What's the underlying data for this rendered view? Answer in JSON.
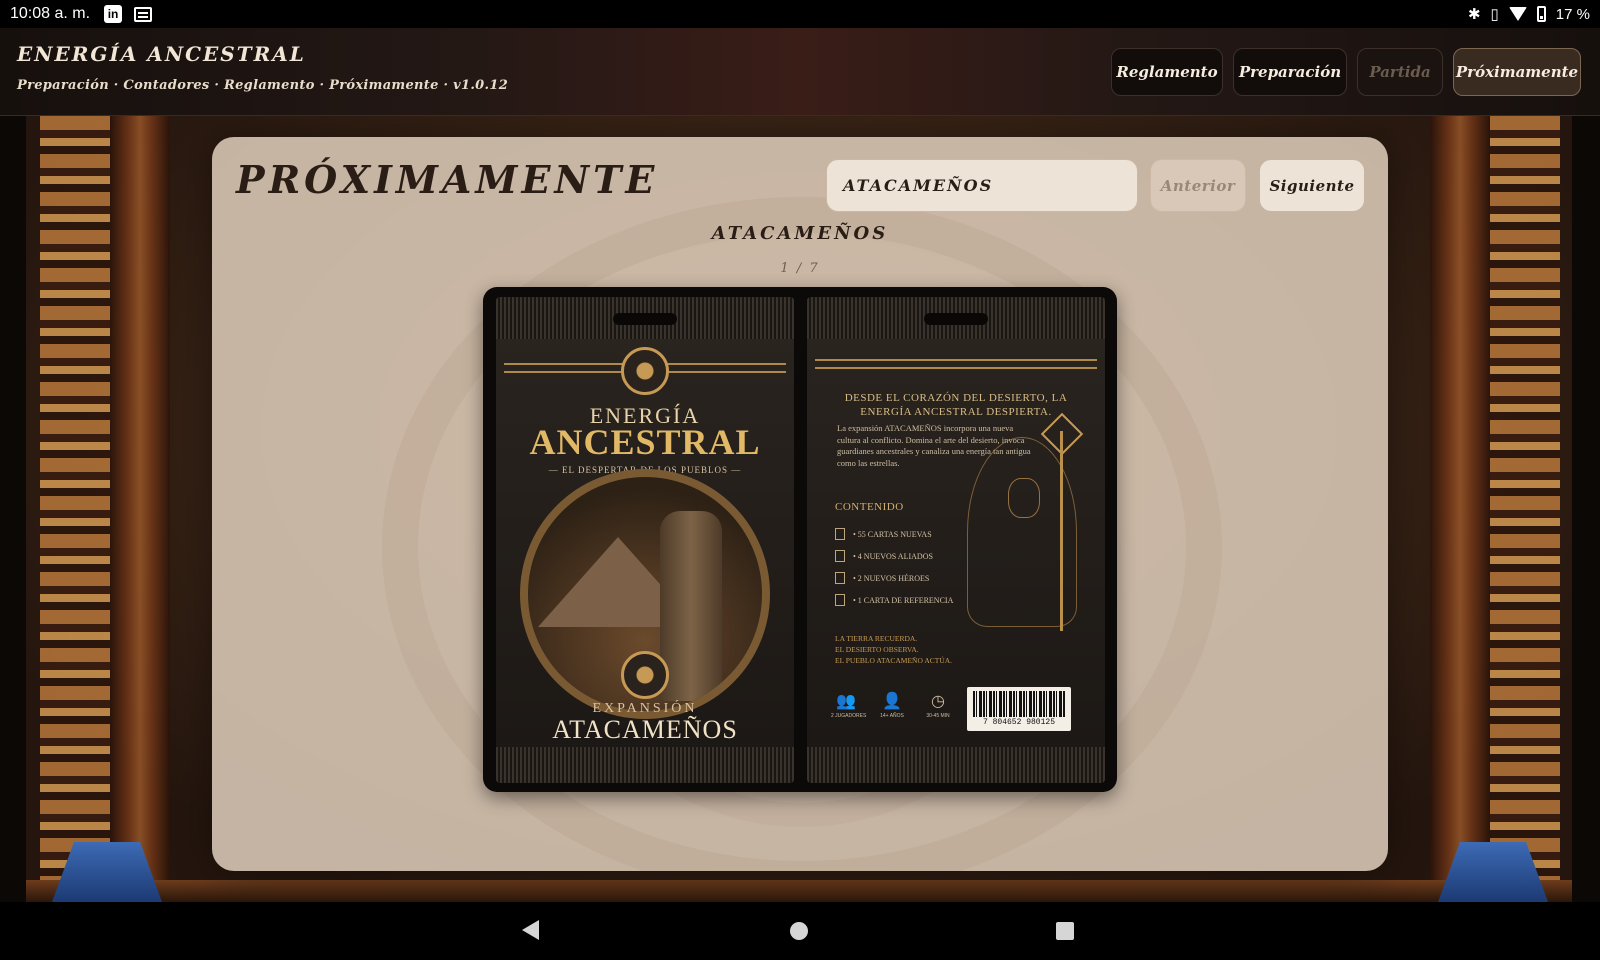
{
  "status_bar": {
    "time": "10:08 a. m.",
    "app_icons": [
      "linkedin-icon",
      "news-icon"
    ],
    "system_icons": [
      "bluetooth-icon",
      "vibrate-icon",
      "wifi-icon",
      "battery-icon"
    ],
    "battery": "17 %"
  },
  "app": {
    "title": "ENERGÍA ANCESTRAL",
    "subtitle": "Preparación · Contadores · Reglamento · Próximamente · v1.0.12",
    "nav": [
      {
        "label": "Reglamento",
        "state": "enabled"
      },
      {
        "label": "Preparación",
        "state": "enabled"
      },
      {
        "label": "Partida",
        "state": "disabled"
      },
      {
        "label": "Próximamente",
        "state": "active"
      }
    ]
  },
  "page": {
    "title": "PRÓXIMAMENTE",
    "selected_expansion": "ATACAMEÑOS",
    "prev_label": "Anterior",
    "next_label": "Siguiente",
    "expansion_heading": "ATACAMEÑOS",
    "counter": "1 / 7"
  },
  "product": {
    "front": {
      "brand_line1": "ENERGÍA",
      "brand_line2": "ANCESTRAL",
      "tagline": "— EL DESPERTAR DE LOS PUEBLOS —",
      "expansion_label": "EXPANSIÓN",
      "expansion_name": "ATACAMEÑOS"
    },
    "back": {
      "headline": "DESDE EL CORAZÓN DEL DESIERTO, LA ENERGÍA ANCESTRAL DESPIERTA.",
      "body": "La expansión ATACAMEÑOS incorpora una nueva cultura al conflicto. Domina el arte del desierto, invoca guardianes ancestrales y canaliza una energía tan antigua como las estrellas.",
      "contents_title": "CONTENIDO",
      "contents": [
        "• 55 CARTAS NUEVAS",
        "• 4 NUEVOS ALIADOS",
        "• 2 NUEVOS HÉROES",
        "• 1 CARTA DE REFERENCIA"
      ],
      "quote": [
        "LA TIERRA RECUERDA.",
        "EL DESIERTO OBSERVA.",
        "EL PUEBLO ATACAMEÑO ACTÚA."
      ],
      "players": "2 JUGADORES",
      "age": "14+ AÑOS",
      "duration": "30-45 MIN",
      "barcode": "7 804652 980125"
    }
  }
}
